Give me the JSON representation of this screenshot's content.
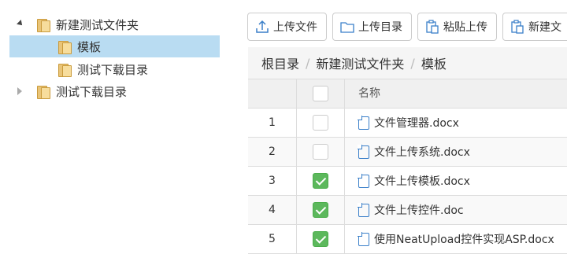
{
  "tree": {
    "nodes": [
      {
        "label": "新建测试文件夹",
        "state": "expanded",
        "icon": "folder-icon"
      },
      {
        "label": "模板",
        "state": "selected",
        "icon": "folder-icon"
      },
      {
        "label": "测试下载目录",
        "state": "leaf",
        "icon": "folder-icon"
      },
      {
        "label": "测试下载目录",
        "state": "collapsed",
        "icon": "folder-icon"
      }
    ]
  },
  "toolbar": {
    "upload_file": "上传文件",
    "upload_dir": "上传目录",
    "paste_upload": "粘贴上传",
    "new_folder": "新建文"
  },
  "breadcrumb": [
    "根目录",
    "新建测试文件夹",
    "模板"
  ],
  "table": {
    "header": {
      "name": "名称"
    },
    "rows": [
      {
        "index": "1",
        "checked": false,
        "name": "文件管理器.docx"
      },
      {
        "index": "2",
        "checked": false,
        "name": "文件上传系统.docx"
      },
      {
        "index": "3",
        "checked": true,
        "name": "文件上传模板.docx"
      },
      {
        "index": "4",
        "checked": true,
        "name": "文件上传控件.doc"
      },
      {
        "index": "5",
        "checked": true,
        "name": "使用NeatUpload控件实现ASP.docx"
      }
    ]
  },
  "colors": {
    "selection": "#b9dcf2",
    "checkbox_checked": "#5cb85c",
    "doc_icon": "#3a7fc9",
    "folder": "#e9c477"
  }
}
